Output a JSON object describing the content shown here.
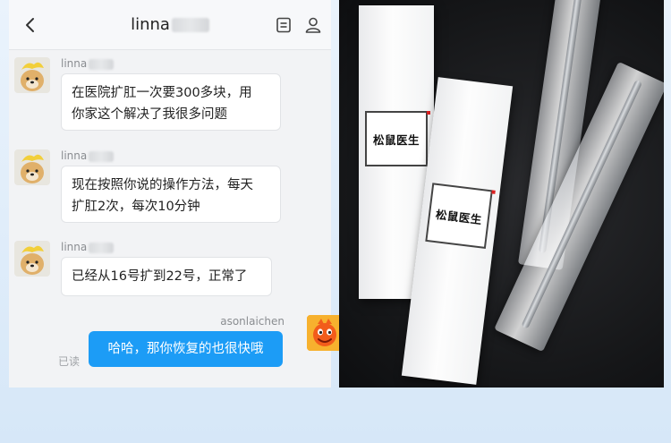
{
  "header": {
    "title": "linna",
    "back_icon": "chevron-left-icon",
    "note_icon": "note-icon",
    "profile_icon": "person-icon"
  },
  "messages": [
    {
      "sender": "linna",
      "text_lines": [
        "在医院扩肛一次要300多块，用",
        "你家这个解决了我很多问题"
      ]
    },
    {
      "sender": "linna",
      "text_lines": [
        "现在按照你说的操作方法，每天",
        "扩肛2次，每次10分钟"
      ]
    },
    {
      "sender": "linna",
      "text_lines": [
        "已经从16号扩到22号，正常了"
      ]
    }
  ],
  "reply": {
    "sender": "asonlaichen",
    "text": "哈哈，那你恢复的也很快哦",
    "status": "已读"
  },
  "product": {
    "brand": "松鼠医生"
  },
  "colors": {
    "accent": "#1c9cf6",
    "chat_bg": "#f2f3f5",
    "photo_bg": "#151618"
  }
}
